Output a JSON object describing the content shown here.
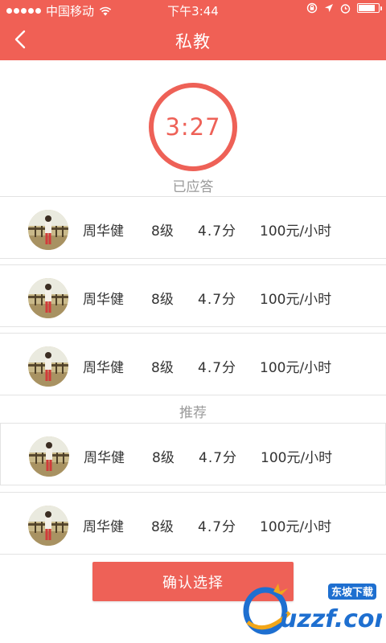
{
  "statusbar": {
    "carrier": "中国移动",
    "time": "下午3:44",
    "battery_level": 0.85
  },
  "navbar": {
    "back_icon": "chevron-left-icon",
    "title": "私教"
  },
  "timer": {
    "value": "3:27",
    "status": "已应答"
  },
  "answered_coaches": [
    {
      "name": "周华健",
      "level": "8级",
      "score": "4.7分",
      "price": "100元/小时"
    },
    {
      "name": "周华健",
      "level": "8级",
      "score": "4.7分",
      "price": "100元/小时"
    },
    {
      "name": "周华健",
      "level": "8级",
      "score": "4.7分",
      "price": "100元/小时"
    }
  ],
  "recommend": {
    "label": "推荐",
    "coaches": [
      {
        "name": "周华健",
        "level": "8级",
        "score": "4.7分",
        "price": "100元/小时"
      },
      {
        "name": "周华健",
        "level": "8级",
        "score": "4.7分",
        "price": "100元/小时"
      }
    ]
  },
  "confirm_label": "确认选择",
  "watermark": {
    "brand": "uzzf.com",
    "badge": "东坡下载"
  },
  "colors": {
    "accent": "#ee6157",
    "navbar": "#f06055",
    "muted_text": "#9a9a9a"
  }
}
